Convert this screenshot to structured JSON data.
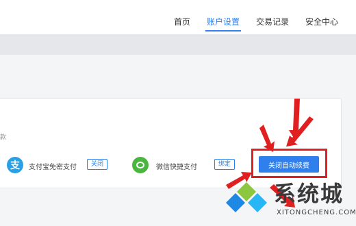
{
  "nav": {
    "items": [
      {
        "label": "首页",
        "active": false
      },
      {
        "label": "账户设置",
        "active": true
      },
      {
        "label": "交易记录",
        "active": false
      },
      {
        "label": "安全中心",
        "active": false
      }
    ]
  },
  "card": {
    "hint": "款",
    "payments": [
      {
        "icon": "alipay-icon",
        "icon_glyph": "支",
        "label": "支付宝免密支付",
        "button": "关闭"
      },
      {
        "icon": "wechat-icon",
        "label": "微信快捷支付",
        "button": "绑定"
      }
    ],
    "primary_button": "关闭自动续费"
  },
  "watermark": {
    "title": "系统城",
    "subtitle": "XITONGCHENG.COM"
  },
  "colors": {
    "accent": "#2f80ed",
    "annotation": "#e02020",
    "alipay": "#27a0e6",
    "wechat": "#4ab53f"
  }
}
